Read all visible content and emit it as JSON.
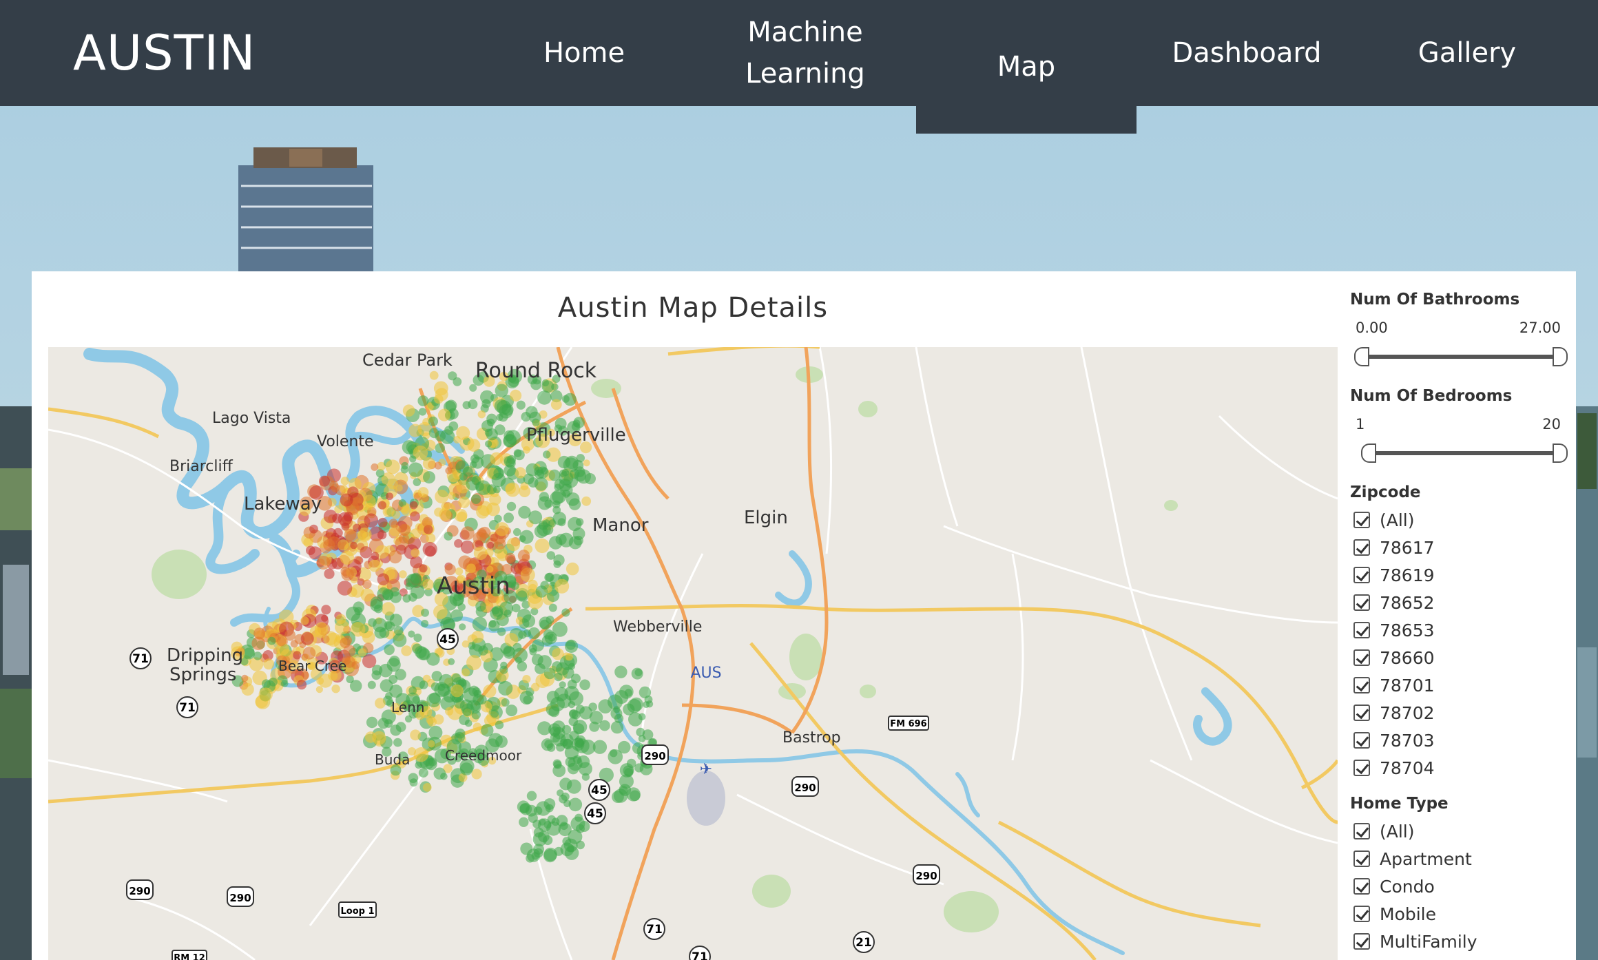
{
  "navbar": {
    "brand": "AUSTIN",
    "items": [
      {
        "label": "Home"
      },
      {
        "label_line1": "Machine",
        "label_line2": "Learning"
      },
      {
        "label": "Map"
      },
      {
        "label": "Dashboard"
      },
      {
        "label": "Gallery"
      }
    ],
    "active": "Map"
  },
  "map": {
    "title": "Austin Map Details",
    "places": {
      "cedar_park": "Cedar Park",
      "round_rock": "Round Rock",
      "lago_vista": "Lago Vista",
      "pflugerville": "Pflugerville",
      "volente": "Volente",
      "briarcliff": "Briarcliff",
      "lakeway": "Lakeway",
      "manor": "Manor",
      "elgin": "Elgin",
      "austin": "Austin",
      "webberville": "Webberville",
      "dripping_springs_1": "Dripping",
      "dripping_springs_2": "Springs",
      "bear_creek": "Bear Cree",
      "aus": "AUS",
      "bastrop": "Bastrop",
      "creedmoor": "Creedmoor",
      "buda": "Buda",
      "lenn": "Lenn"
    },
    "shields": {
      "s71a": "71",
      "s71b": "71",
      "s71c": "71",
      "s71d": "71",
      "s45a": "45",
      "s45b": "45",
      "s45c": "45",
      "s290a": "290",
      "s290b": "290",
      "s290c": "290",
      "s290d": "290",
      "s290e": "290",
      "s21": "21",
      "loop1": "Loop 1",
      "rm12": "RM 12",
      "fm696": "FM 696"
    },
    "colors": {
      "low": "#3fa84a",
      "mid": "#f0c43a",
      "high": "#e0742e",
      "top": "#c9302c"
    }
  },
  "filters": {
    "bathrooms": {
      "title": "Num Of Bathrooms",
      "min": "0.00",
      "max": "27.00"
    },
    "bedrooms": {
      "title": "Num Of Bedrooms",
      "min": "1",
      "max": "20"
    },
    "zipcode": {
      "title": "Zipcode",
      "items": [
        "(All)",
        "78617",
        "78619",
        "78652",
        "78653",
        "78660",
        "78701",
        "78702",
        "78703",
        "78704"
      ]
    },
    "home_type": {
      "title": "Home Type",
      "items": [
        "(All)",
        "Apartment",
        "Condo",
        "Mobile",
        "MultiFamily"
      ]
    }
  }
}
